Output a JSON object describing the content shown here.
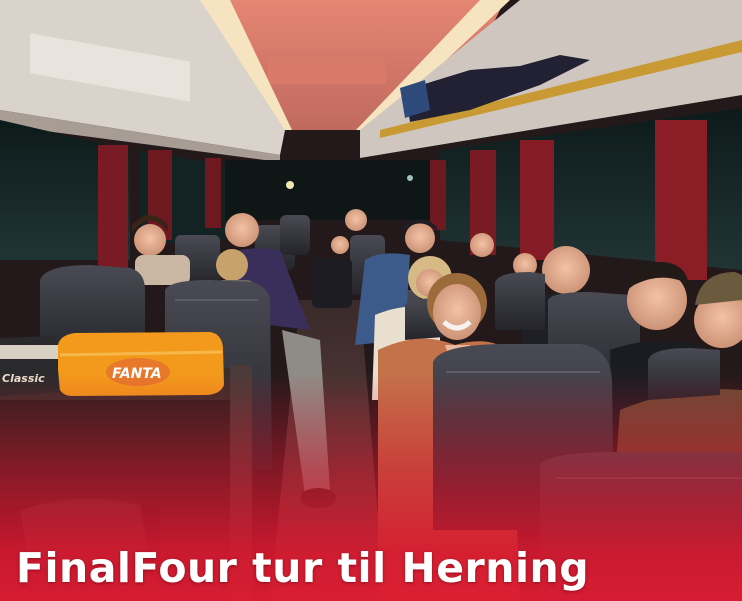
{
  "caption": {
    "title": "FinalFour tur til Herning"
  },
  "products": {
    "fanta_bag_label": "FANTA",
    "chips_bag_label": "Classic"
  },
  "colors": {
    "accent_red": "#d81c32",
    "fanta_orange": "#f39a1c",
    "ceiling_light": "#f6e3bf",
    "seat_dark": "#2b2a30"
  }
}
